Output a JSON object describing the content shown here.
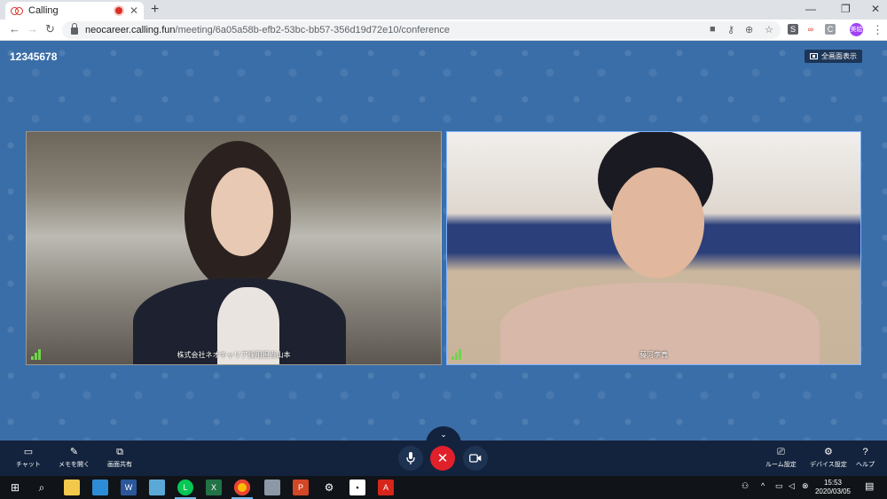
{
  "browser": {
    "tab_title": "Calling",
    "tab_close": "✕",
    "new_tab": "+",
    "url_host": "neocareer.calling.fun",
    "url_path": "/meeting/6a05a58b-efb2-53bc-bb57-356d19d72e10/conference",
    "avatar_text": "美絵",
    "window_controls": [
      "—",
      "❐",
      "✕"
    ]
  },
  "meeting": {
    "id": "12345678",
    "fullscreen_label": "全画面表示"
  },
  "participants": [
    {
      "name": "株式会社ネオキャリア採用担当山本"
    },
    {
      "name": "藤河李真"
    }
  ],
  "controls": {
    "left": [
      {
        "label": "チャット",
        "icon": "chat-icon"
      },
      {
        "label": "メモを開く",
        "icon": "pencil-icon"
      },
      {
        "label": "画面共有",
        "icon": "screen-share-icon"
      }
    ],
    "right": [
      {
        "label": "ルーム設定",
        "icon": "room-settings-icon"
      },
      {
        "label": "デバイス設定",
        "icon": "gear-icon"
      },
      {
        "label": "ヘルプ",
        "icon": "help-icon"
      }
    ],
    "toggle": "⌄"
  },
  "taskbar": {
    "time": "15:53",
    "date": "2020/03/05",
    "apps": [
      "file-explorer",
      "edge",
      "word",
      "app",
      "line",
      "excel",
      "chrome",
      "app",
      "powerpoint",
      "settings",
      "note",
      "acrobat"
    ]
  }
}
